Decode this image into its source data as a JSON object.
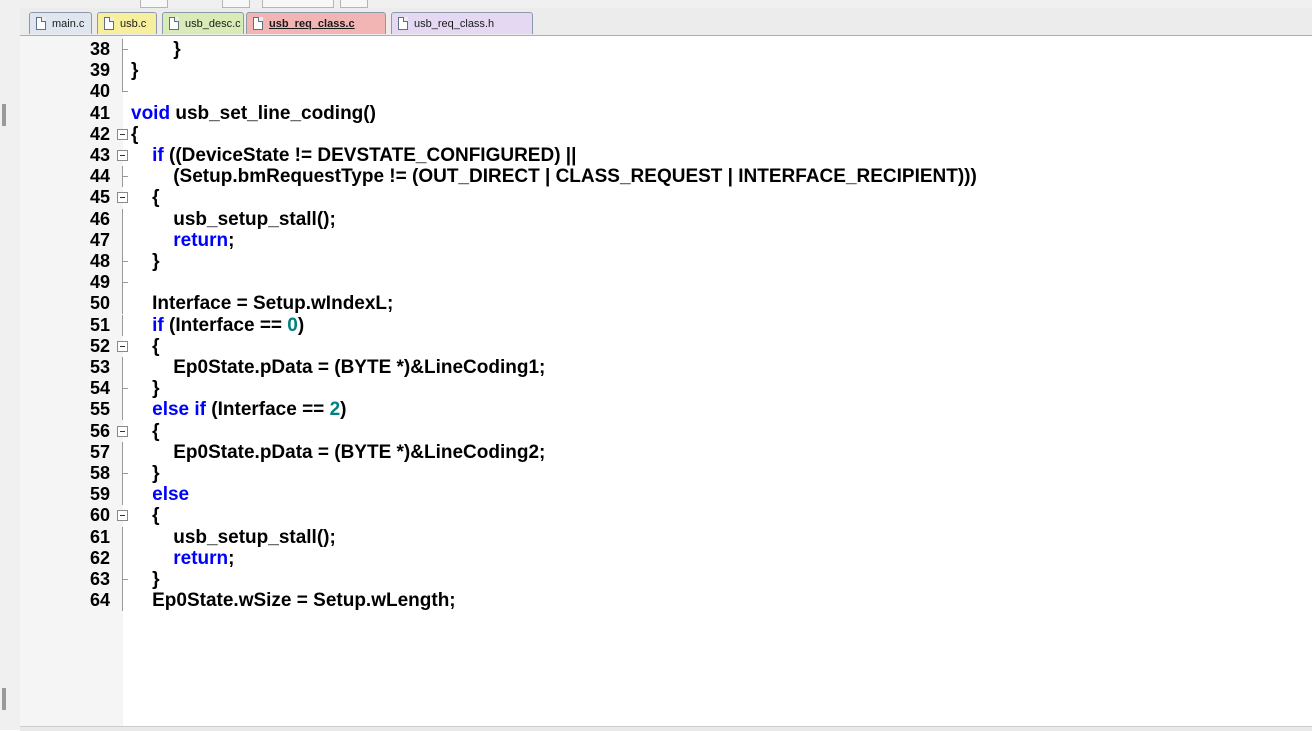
{
  "tabs": [
    {
      "label": "main.c",
      "color": "#dfe6ef",
      "active": false
    },
    {
      "label": "usb.c",
      "color": "#f7ef9c",
      "active": false
    },
    {
      "label": "usb_desc.c",
      "color": "#d9ebb7",
      "active": false
    },
    {
      "label": "usb_req_class.c",
      "color": "#f3b4b4",
      "active": true
    },
    {
      "label": "usb_req_class.h",
      "color": "#e4d8f3",
      "active": false
    }
  ],
  "editor": {
    "keyword_color": "#0000ff",
    "number_color": "#008080",
    "lines": [
      {
        "n": "38",
        "fold": "tick",
        "tokens": [
          {
            "t": "        }",
            "k": ""
          }
        ]
      },
      {
        "n": "39",
        "fold": "line",
        "tokens": [
          {
            "t": "}",
            "k": ""
          }
        ]
      },
      {
        "n": "40",
        "fold": "end",
        "tokens": []
      },
      {
        "n": "41",
        "fold": "",
        "tokens": [
          {
            "t": "void",
            "k": "kw"
          },
          {
            "t": " usb_set_line_coding()",
            "k": ""
          }
        ]
      },
      {
        "n": "42",
        "fold": "box",
        "tokens": [
          {
            "t": "{",
            "k": ""
          }
        ]
      },
      {
        "n": "43",
        "fold": "box",
        "tokens": [
          {
            "t": "    ",
            "k": ""
          },
          {
            "t": "if",
            "k": "kw"
          },
          {
            "t": " ((DeviceState != DEVSTATE_CONFIGURED) ||",
            "k": ""
          }
        ]
      },
      {
        "n": "44",
        "fold": "tick",
        "tokens": [
          {
            "t": "        (Setup.bmRequestType != (OUT_DIRECT | CLASS_REQUEST | INTERFACE_RECIPIENT)))",
            "k": ""
          }
        ]
      },
      {
        "n": "45",
        "fold": "box",
        "tokens": [
          {
            "t": "    {",
            "k": ""
          }
        ]
      },
      {
        "n": "46",
        "fold": "line",
        "tokens": [
          {
            "t": "        usb_setup_stall();",
            "k": ""
          }
        ]
      },
      {
        "n": "47",
        "fold": "line",
        "tokens": [
          {
            "t": "        ",
            "k": ""
          },
          {
            "t": "return",
            "k": "kw"
          },
          {
            "t": ";",
            "k": ""
          }
        ]
      },
      {
        "n": "48",
        "fold": "tick",
        "tokens": [
          {
            "t": "    }",
            "k": ""
          }
        ]
      },
      {
        "n": "49",
        "fold": "tick",
        "tokens": []
      },
      {
        "n": "50",
        "fold": "line",
        "tokens": [
          {
            "t": "    Interface = Setup.wIndexL;",
            "k": ""
          }
        ]
      },
      {
        "n": "51",
        "fold": "line",
        "tokens": [
          {
            "t": "    ",
            "k": ""
          },
          {
            "t": "if",
            "k": "kw"
          },
          {
            "t": " (Interface == ",
            "k": ""
          },
          {
            "t": "0",
            "k": "num"
          },
          {
            "t": ")",
            "k": ""
          }
        ]
      },
      {
        "n": "52",
        "fold": "box",
        "tokens": [
          {
            "t": "    {",
            "k": ""
          }
        ]
      },
      {
        "n": "53",
        "fold": "line",
        "tokens": [
          {
            "t": "        Ep0State.pData = (BYTE *)&LineCoding1;",
            "k": ""
          }
        ]
      },
      {
        "n": "54",
        "fold": "tick",
        "tokens": [
          {
            "t": "    }",
            "k": ""
          }
        ]
      },
      {
        "n": "55",
        "fold": "line",
        "tokens": [
          {
            "t": "    ",
            "k": ""
          },
          {
            "t": "else if",
            "k": "kw"
          },
          {
            "t": " (Interface == ",
            "k": ""
          },
          {
            "t": "2",
            "k": "num"
          },
          {
            "t": ")",
            "k": ""
          }
        ]
      },
      {
        "n": "56",
        "fold": "box",
        "tokens": [
          {
            "t": "    {",
            "k": ""
          }
        ]
      },
      {
        "n": "57",
        "fold": "line",
        "tokens": [
          {
            "t": "        Ep0State.pData = (BYTE *)&LineCoding2;",
            "k": ""
          }
        ]
      },
      {
        "n": "58",
        "fold": "tick",
        "tokens": [
          {
            "t": "    }",
            "k": ""
          }
        ]
      },
      {
        "n": "59",
        "fold": "line",
        "tokens": [
          {
            "t": "    ",
            "k": ""
          },
          {
            "t": "else",
            "k": "kw"
          }
        ]
      },
      {
        "n": "60",
        "fold": "box",
        "tokens": [
          {
            "t": "    {",
            "k": ""
          }
        ]
      },
      {
        "n": "61",
        "fold": "line",
        "tokens": [
          {
            "t": "        usb_setup_stall();",
            "k": ""
          }
        ]
      },
      {
        "n": "62",
        "fold": "line",
        "tokens": [
          {
            "t": "        ",
            "k": ""
          },
          {
            "t": "return",
            "k": "kw"
          },
          {
            "t": ";",
            "k": ""
          }
        ]
      },
      {
        "n": "63",
        "fold": "tick",
        "tokens": [
          {
            "t": "    }",
            "k": ""
          }
        ]
      },
      {
        "n": "64",
        "fold": "line",
        "tokens": [
          {
            "t": "    Ep0State.wSize = Setup.wLength;",
            "k": ""
          }
        ]
      }
    ]
  }
}
